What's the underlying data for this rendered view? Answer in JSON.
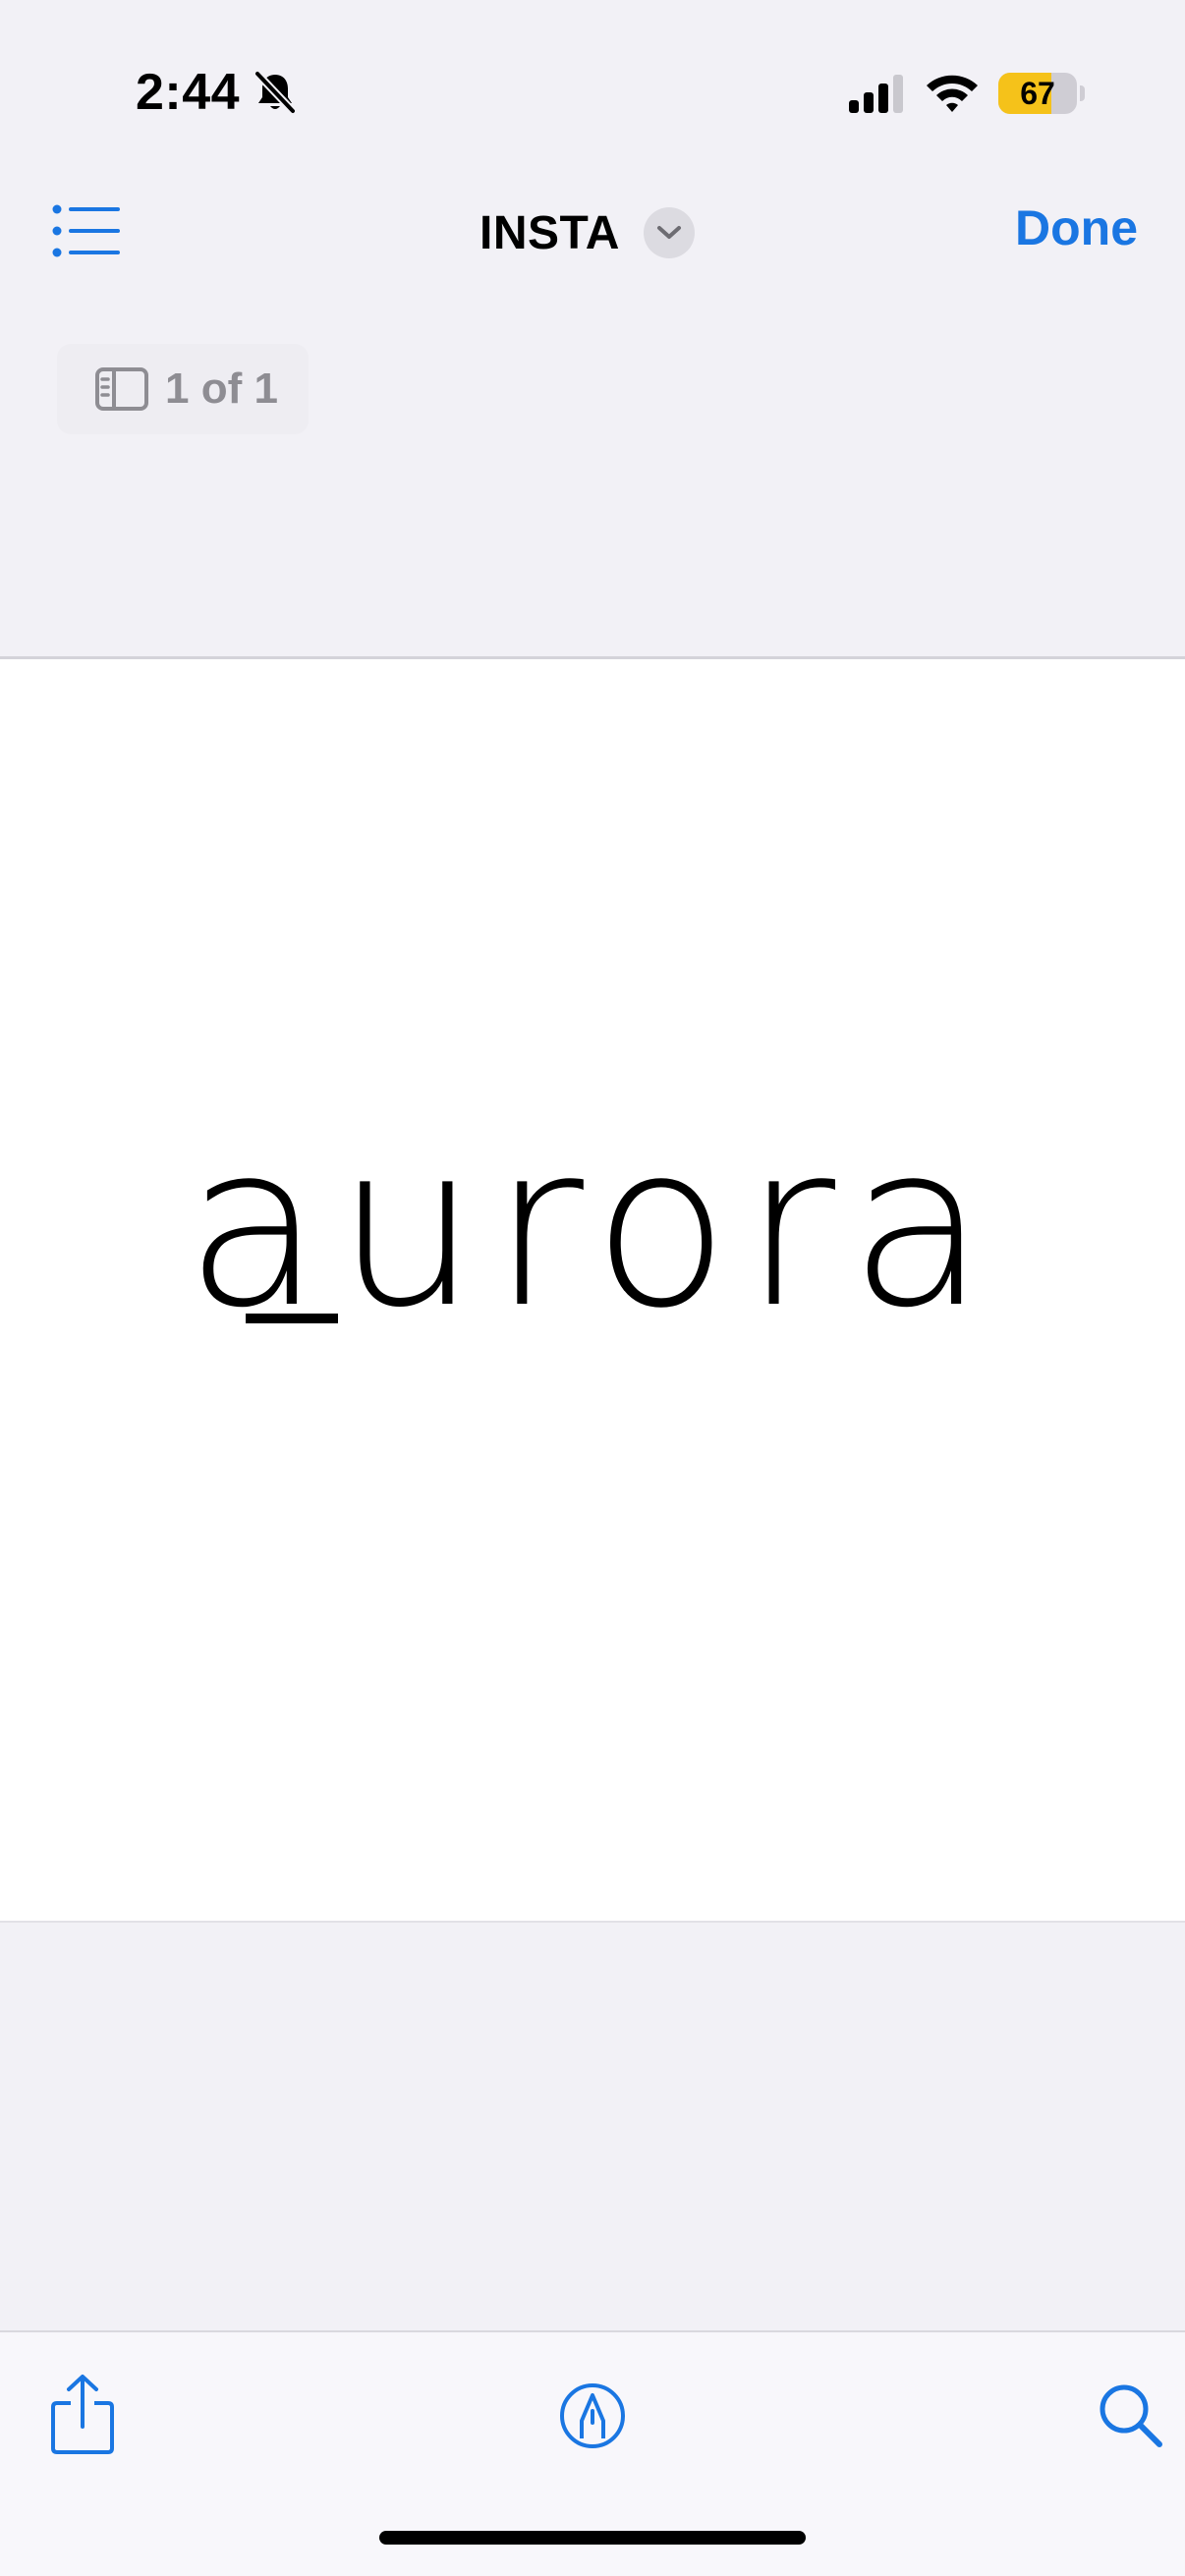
{
  "status_bar": {
    "time": "2:44",
    "battery_level": "67",
    "battery_fraction": 0.67,
    "icons": [
      "bell-slash-icon",
      "cellular-signal-icon",
      "wifi-icon",
      "battery-icon"
    ]
  },
  "nav_bar": {
    "list_icon": "list-bullet-icon",
    "title": "INSTA",
    "title_icon": "chevron-down-icon",
    "done_label": "Done"
  },
  "page_indicator": {
    "icon": "sidebar-icon",
    "label": "1 of 1"
  },
  "document": {
    "logo_text": "aurora"
  },
  "toolbar": {
    "icons": [
      "share-icon",
      "markup-pen-icon",
      "search-icon"
    ]
  },
  "colors": {
    "accent": "#1a76e2",
    "background": "#f2f1f6",
    "page": "#ffffff",
    "battery": "#f5c21a"
  }
}
